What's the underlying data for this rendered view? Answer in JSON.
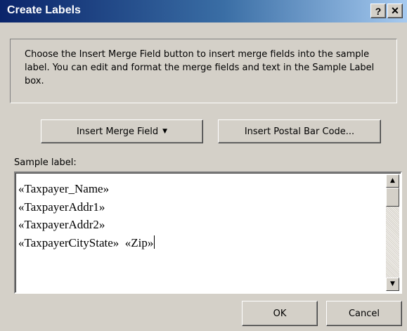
{
  "window": {
    "title": "Create Labels",
    "help_button": "?",
    "close_button": "✕"
  },
  "instructions": {
    "text": "Choose the Insert Merge Field button to insert merge fields into the sample label.  You can edit and format the merge fields and text in the Sample Label box."
  },
  "buttons": {
    "insert_merge_field": "Insert Merge Field",
    "insert_merge_field_arrow": "▼",
    "insert_postal_bar_code": "Insert Postal Bar Code...",
    "ok": "OK",
    "cancel": "Cancel"
  },
  "sample_label": {
    "caption": "Sample label:",
    "lines": [
      "«Taxpayer_Name»",
      "«TaxpayerAddr1»",
      "«TaxpayerAddr2»",
      "«TaxpayerCityState»  «Zip»"
    ]
  },
  "scrollbar": {
    "up_arrow": "▲",
    "down_arrow": "▼"
  }
}
